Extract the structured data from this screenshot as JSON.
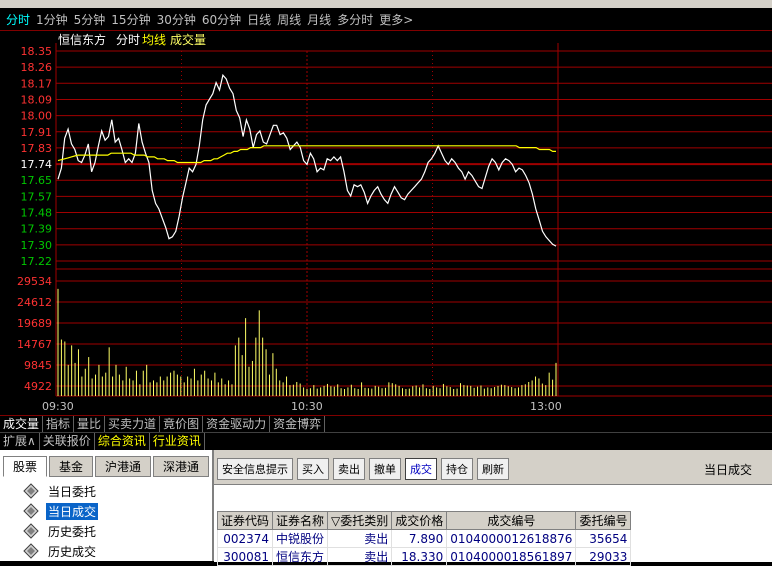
{
  "period_tabs": [
    "分时",
    "1分钟",
    "5分钟",
    "15分钟",
    "30分钟",
    "60分钟",
    "日线",
    "周线",
    "月线",
    "多分时",
    "更多>"
  ],
  "active_period": 0,
  "chart_header": {
    "stock_name": "恒信东方",
    "mode": "分时",
    "ma": "均线",
    "volume": "成交量"
  },
  "chart_data": {
    "type": "line",
    "price_ticks": [
      "18.35",
      "18.26",
      "18.17",
      "18.09",
      "18.00",
      "17.91",
      "17.83",
      "17.74",
      "17.65",
      "17.57",
      "17.48",
      "17.39",
      "17.30",
      "17.22"
    ],
    "price_ylim": [
      17.22,
      18.35
    ],
    "base_price": 17.74,
    "volume_ticks": [
      "29534",
      "24612",
      "19689",
      "14767",
      "9845",
      "4922"
    ],
    "volume_ylim": [
      0,
      29534
    ],
    "time_ticks": [
      "09:30",
      "10:30",
      "13:00"
    ],
    "series": [
      {
        "values": [
          17.66,
          17.72,
          17.88,
          17.93,
          17.85,
          17.82,
          17.76,
          17.75,
          17.79,
          17.85,
          17.7,
          17.75,
          17.84,
          17.92,
          17.87,
          17.89,
          17.98,
          17.86,
          17.88,
          17.82,
          17.75,
          17.77,
          17.75,
          17.8,
          17.96,
          17.86,
          17.8,
          17.75,
          17.6,
          17.53,
          17.5,
          17.45,
          17.4,
          17.34,
          17.35,
          17.38,
          17.46,
          17.56,
          17.64,
          17.72,
          17.7,
          17.74,
          17.84,
          17.98,
          18.06,
          18.09,
          18.12,
          18.18,
          18.14,
          18.22,
          18.2,
          18.15,
          18.12,
          18.03,
          17.99,
          17.89,
          17.98,
          17.93,
          17.83,
          17.9,
          17.92,
          17.86,
          17.85,
          17.9,
          17.95,
          17.95,
          17.9,
          17.91,
          17.88,
          17.82,
          17.84,
          17.86,
          17.83,
          17.76,
          17.74,
          17.8,
          17.77,
          17.7,
          17.72,
          17.71,
          17.77,
          17.76,
          17.78,
          17.76,
          17.78,
          17.7,
          17.6,
          17.57,
          17.63,
          17.62,
          17.63,
          17.59,
          17.53,
          17.57,
          17.6,
          17.62,
          17.58,
          17.55,
          17.53,
          17.58,
          17.62,
          17.59,
          17.56,
          17.55,
          17.58,
          17.6,
          17.62,
          17.64,
          17.66,
          17.7,
          17.75,
          17.77,
          17.8,
          17.84,
          17.8,
          17.76,
          17.74,
          17.77,
          17.75,
          17.72,
          17.7,
          17.66,
          17.7,
          17.68,
          17.65,
          17.62,
          17.61,
          17.67,
          17.73,
          17.77,
          17.75,
          17.71,
          17.75,
          17.77,
          17.76,
          17.74,
          17.7,
          17.72,
          17.71,
          17.68,
          17.64,
          17.58,
          17.5,
          17.44,
          17.38,
          17.35,
          17.33,
          17.31,
          17.3
        ]
      },
      {
        "values": [
          17.76,
          17.765,
          17.77,
          17.775,
          17.78,
          17.785,
          17.79,
          17.79,
          17.79,
          17.79,
          17.79,
          17.79,
          17.79,
          17.79,
          17.79,
          17.79,
          17.8,
          17.8,
          17.8,
          17.8,
          17.8,
          17.8,
          17.8,
          17.79,
          17.79,
          17.79,
          17.79,
          17.78,
          17.78,
          17.78,
          17.77,
          17.77,
          17.77,
          17.76,
          17.76,
          17.76,
          17.75,
          17.75,
          17.75,
          17.75,
          17.75,
          17.75,
          17.75,
          17.75,
          17.76,
          17.76,
          17.76,
          17.77,
          17.77,
          17.78,
          17.79,
          17.8,
          17.8,
          17.81,
          17.81,
          17.82,
          17.82,
          17.82,
          17.83,
          17.83,
          17.83,
          17.83,
          17.84,
          17.84,
          17.84,
          17.84,
          17.84,
          17.84,
          17.84,
          17.84,
          17.84,
          17.84,
          17.84,
          17.84,
          17.84,
          17.84,
          17.84,
          17.84,
          17.84,
          17.84,
          17.84,
          17.84,
          17.84,
          17.84,
          17.84,
          17.84,
          17.84,
          17.84,
          17.84,
          17.84,
          17.84,
          17.84,
          17.84,
          17.84,
          17.84,
          17.84,
          17.84,
          17.84,
          17.84,
          17.84,
          17.84,
          17.84,
          17.84,
          17.84,
          17.84,
          17.84,
          17.84,
          17.84,
          17.84,
          17.84,
          17.84,
          17.84,
          17.84,
          17.84,
          17.84,
          17.84,
          17.84,
          17.84,
          17.84,
          17.84,
          17.84,
          17.84,
          17.84,
          17.84,
          17.84,
          17.84,
          17.84,
          17.84,
          17.84,
          17.84,
          17.84,
          17.84,
          17.84,
          17.84,
          17.84,
          17.84,
          17.84,
          17.84,
          17.84,
          17.83,
          17.83,
          17.83,
          17.83,
          17.83,
          17.83,
          17.82,
          17.82,
          17.82,
          17.82,
          17.81,
          17.81
        ]
      }
    ],
    "volumes": [
      27500,
      14500,
      14000,
      8000,
      13000,
      8500,
      12000,
      5000,
      7000,
      10000,
      4500,
      5500,
      8000,
      5000,
      6000,
      12500,
      5000,
      8000,
      5500,
      4000,
      7500,
      4500,
      4000,
      6500,
      3000,
      6500,
      8000,
      3500,
      4000,
      3500,
      5000,
      4000,
      5000,
      6000,
      6500,
      5500,
      5000,
      3500,
      5000,
      4500,
      7000,
      4000,
      5500,
      6500,
      4500,
      4000,
      6000,
      3500,
      4500,
      3000,
      4000,
      3000,
      13000,
      15000,
      10500,
      20000,
      7500,
      9000,
      15000,
      22000,
      15000,
      12000,
      5500,
      11000,
      7000,
      4000,
      3500,
      5000,
      2800,
      2900,
      3600,
      3200,
      2200,
      1800,
      2000,
      2800,
      1900,
      2200,
      2600,
      3100,
      2500,
      2400,
      3000,
      2000,
      1800,
      2200,
      2900,
      2000,
      1800,
      3500,
      2100,
      2000,
      1900,
      2600,
      2400,
      2000,
      2100,
      3500,
      3300,
      3000,
      2600,
      2000,
      1800,
      1900,
      2500,
      2700,
      2200,
      3000,
      2000,
      1800,
      2600,
      2200,
      2000,
      3100,
      2500,
      2300,
      1800,
      1900,
      3300,
      2800,
      2700,
      2600,
      2100,
      2400,
      2700,
      1900,
      2200,
      2000,
      2300,
      2600,
      2900,
      2800,
      2500,
      2300,
      2000,
      2200,
      2800,
      3000,
      3600,
      4000,
      5000,
      4500,
      3200,
      2800,
      6000,
      4200,
      8500
    ]
  },
  "sub_tabs": [
    "成交量",
    "指标",
    "量比",
    "买卖力道",
    "竟价图",
    "资金驱动力",
    "资金博弈"
  ],
  "info_tabs": [
    "扩展∧",
    "关联报价",
    "综合资讯",
    "行业资讯"
  ],
  "market_tabs": [
    "股票",
    "基金",
    "沪港通",
    "深港通"
  ],
  "tree_items": [
    "当日委托",
    "当日成交",
    "历史委托",
    "历史成交"
  ],
  "selected_tree_item": 1,
  "toolbar": [
    "安全信息提示",
    "买入",
    "卖出",
    "撤单",
    "成交",
    "持仓",
    "刷新"
  ],
  "panel_title": "当日成交",
  "table": {
    "headers": [
      "证券代码",
      "证券名称",
      "▽委托类别",
      "成交价格",
      "成交编号",
      "委托编号"
    ],
    "rows": [
      [
        "002374",
        "中锐股份",
        "卖出",
        "7.890",
        "0104000012618876",
        "35654"
      ],
      [
        "300081",
        "恒信东方",
        "卖出",
        "18.330",
        "0104000018561897",
        "29033"
      ]
    ]
  },
  "colors": {
    "up": "#ff3232",
    "down": "#00c800",
    "grid": "#a00000",
    "price_line": "#ffffff",
    "avg_line": "#ffff00",
    "volume": "#ffff66",
    "active_tab": "#00ffff"
  }
}
